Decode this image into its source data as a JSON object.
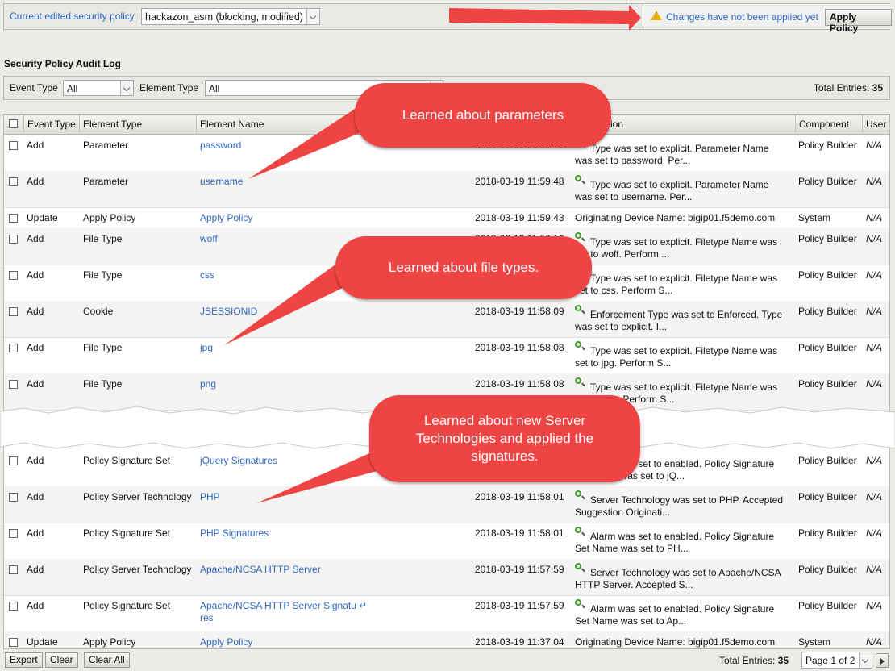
{
  "topbar": {
    "label": "Current edited security policy",
    "policy_value": "hackazon_asm (blocking, modified)",
    "warning_text": "Changes have not been applied yet",
    "apply_label": "Apply Policy"
  },
  "section_title": "Security Policy Audit Log",
  "filters": {
    "event_type_label": "Event Type",
    "event_type_value": "All",
    "element_type_label": "Element Type",
    "element_type_value": "All",
    "total_label": "Total Entries:",
    "total_value": "35"
  },
  "columns": [
    "Event Type",
    "Element Type",
    "Element Name",
    "Description",
    "Component",
    "User"
  ],
  "rows_top": [
    {
      "event": "Add",
      "etype": "Parameter",
      "name": "password",
      "date": "2018-03-19 11:59:48",
      "d1": "Type was set to explicit. Parameter Name",
      "d2": "was set to password. Per...",
      "comp": "Policy Builder",
      "user": "N/A",
      "icon": true
    },
    {
      "event": "Add",
      "etype": "Parameter",
      "name": "username",
      "date": "2018-03-19 11:59:48",
      "d1": "Type was set to explicit. Parameter Name",
      "d2": "was set to username. Per...",
      "comp": "Policy Builder",
      "user": "N/A",
      "icon": true
    },
    {
      "event": "Update",
      "etype": "Apply Policy",
      "name": "Apply Policy",
      "date": "2018-03-19 11:59:43",
      "d1": "Originating Device Name: bigip01.f5demo.com",
      "d2": "",
      "comp": "System",
      "user": "N/A",
      "icon": false
    },
    {
      "event": "Add",
      "etype": "File Type",
      "name": "woff",
      "date": "2018-03-19 11:59:13",
      "d1": "Type was set to explicit. Filetype Name was",
      "d2": "set to woff. Perform ...",
      "comp": "Policy Builder",
      "user": "N/A",
      "icon": true
    },
    {
      "event": "Add",
      "etype": "File Type",
      "name": "css",
      "date": "2018-03-19 11:59:13",
      "d1": "Type was set to explicit. Filetype Name was",
      "d2": "set to css. Perform S...",
      "comp": "Policy Builder",
      "user": "N/A",
      "icon": true
    },
    {
      "event": "Add",
      "etype": "Cookie",
      "name": "JSESSIONID",
      "date": "2018-03-19 11:58:09",
      "d1": "Enforcement Type was set to Enforced. Type",
      "d2": "was set to explicit. I...",
      "comp": "Policy Builder",
      "user": "N/A",
      "icon": true
    },
    {
      "event": "Add",
      "etype": "File Type",
      "name": "jpg",
      "date": "2018-03-19 11:58:08",
      "d1": "Type was set to explicit. Filetype Name was",
      "d2": "set to jpg. Perform S...",
      "comp": "Policy Builder",
      "user": "N/A",
      "icon": true
    },
    {
      "event": "Add",
      "etype": "File Type",
      "name": "png",
      "date": "2018-03-19 11:58:08",
      "d1": "Type was set to explicit. Filetype Name was",
      "d2": "set to png. Perform S...",
      "comp": "Policy Builder",
      "user": "N/A",
      "icon": true
    }
  ],
  "rows_bottom": [
    {
      "event": "Add",
      "etype": "Policy Signature Set",
      "name": "jQuery Signatures",
      "date": "2018-03-19 11:58:01",
      "d1": "Alarm was set to enabled. Policy Signature",
      "d2": "Set Name was set to jQ...",
      "comp": "Policy Builder",
      "user": "N/A",
      "icon": true
    },
    {
      "event": "Add",
      "etype": "Policy Server Technology",
      "name": "PHP",
      "date": "2018-03-19 11:58:01",
      "d1": "Server Technology was set to PHP. Accepted",
      "d2": "Suggestion Originati...",
      "comp": "Policy Builder",
      "user": "N/A",
      "icon": true
    },
    {
      "event": "Add",
      "etype": "Policy Signature Set",
      "name": "PHP Signatures",
      "date": "2018-03-19 11:58:01",
      "d1": "Alarm was set to enabled. Policy Signature",
      "d2": "Set Name was set to PH...",
      "comp": "Policy Builder",
      "user": "N/A",
      "icon": true
    },
    {
      "event": "Add",
      "etype": "Policy Server Technology",
      "name": "Apache/NCSA HTTP Server",
      "date": "2018-03-19 11:57:59",
      "d1": "Server Technology was set to Apache/NCSA",
      "d2": "HTTP Server. Accepted S...",
      "comp": "Policy Builder",
      "user": "N/A",
      "icon": true
    },
    {
      "event": "Add",
      "etype": "Policy Signature Set",
      "name": "Apache/NCSA HTTP Server Signatu ↵",
      "name2": "res",
      "date": "2018-03-19 11:57:59",
      "d1": "Alarm was set to enabled. Policy Signature",
      "d2": "Set Name was set to Ap...",
      "comp": "Policy Builder",
      "user": "N/A",
      "icon": true
    },
    {
      "event": "Update",
      "etype": "Apply Policy",
      "name": "Apply Policy",
      "date": "2018-03-19 11:37:04",
      "d1": "Originating Device Name: bigip01.f5demo.com",
      "d2": "",
      "comp": "System",
      "user": "N/A",
      "icon": false
    }
  ],
  "footer": {
    "export": "Export",
    "clear": "Clear",
    "clear_all": "Clear All",
    "total_label": "Total Entries:",
    "total_value": "35",
    "page": "Page 1 of 2"
  },
  "callouts": {
    "params": "Learned about parameters",
    "files": "Learned about file types.",
    "servers": "Learned about new Server Technologies and applied the signatures."
  },
  "colors": {
    "callout": "#ee4444",
    "link": "#2f68c4"
  }
}
